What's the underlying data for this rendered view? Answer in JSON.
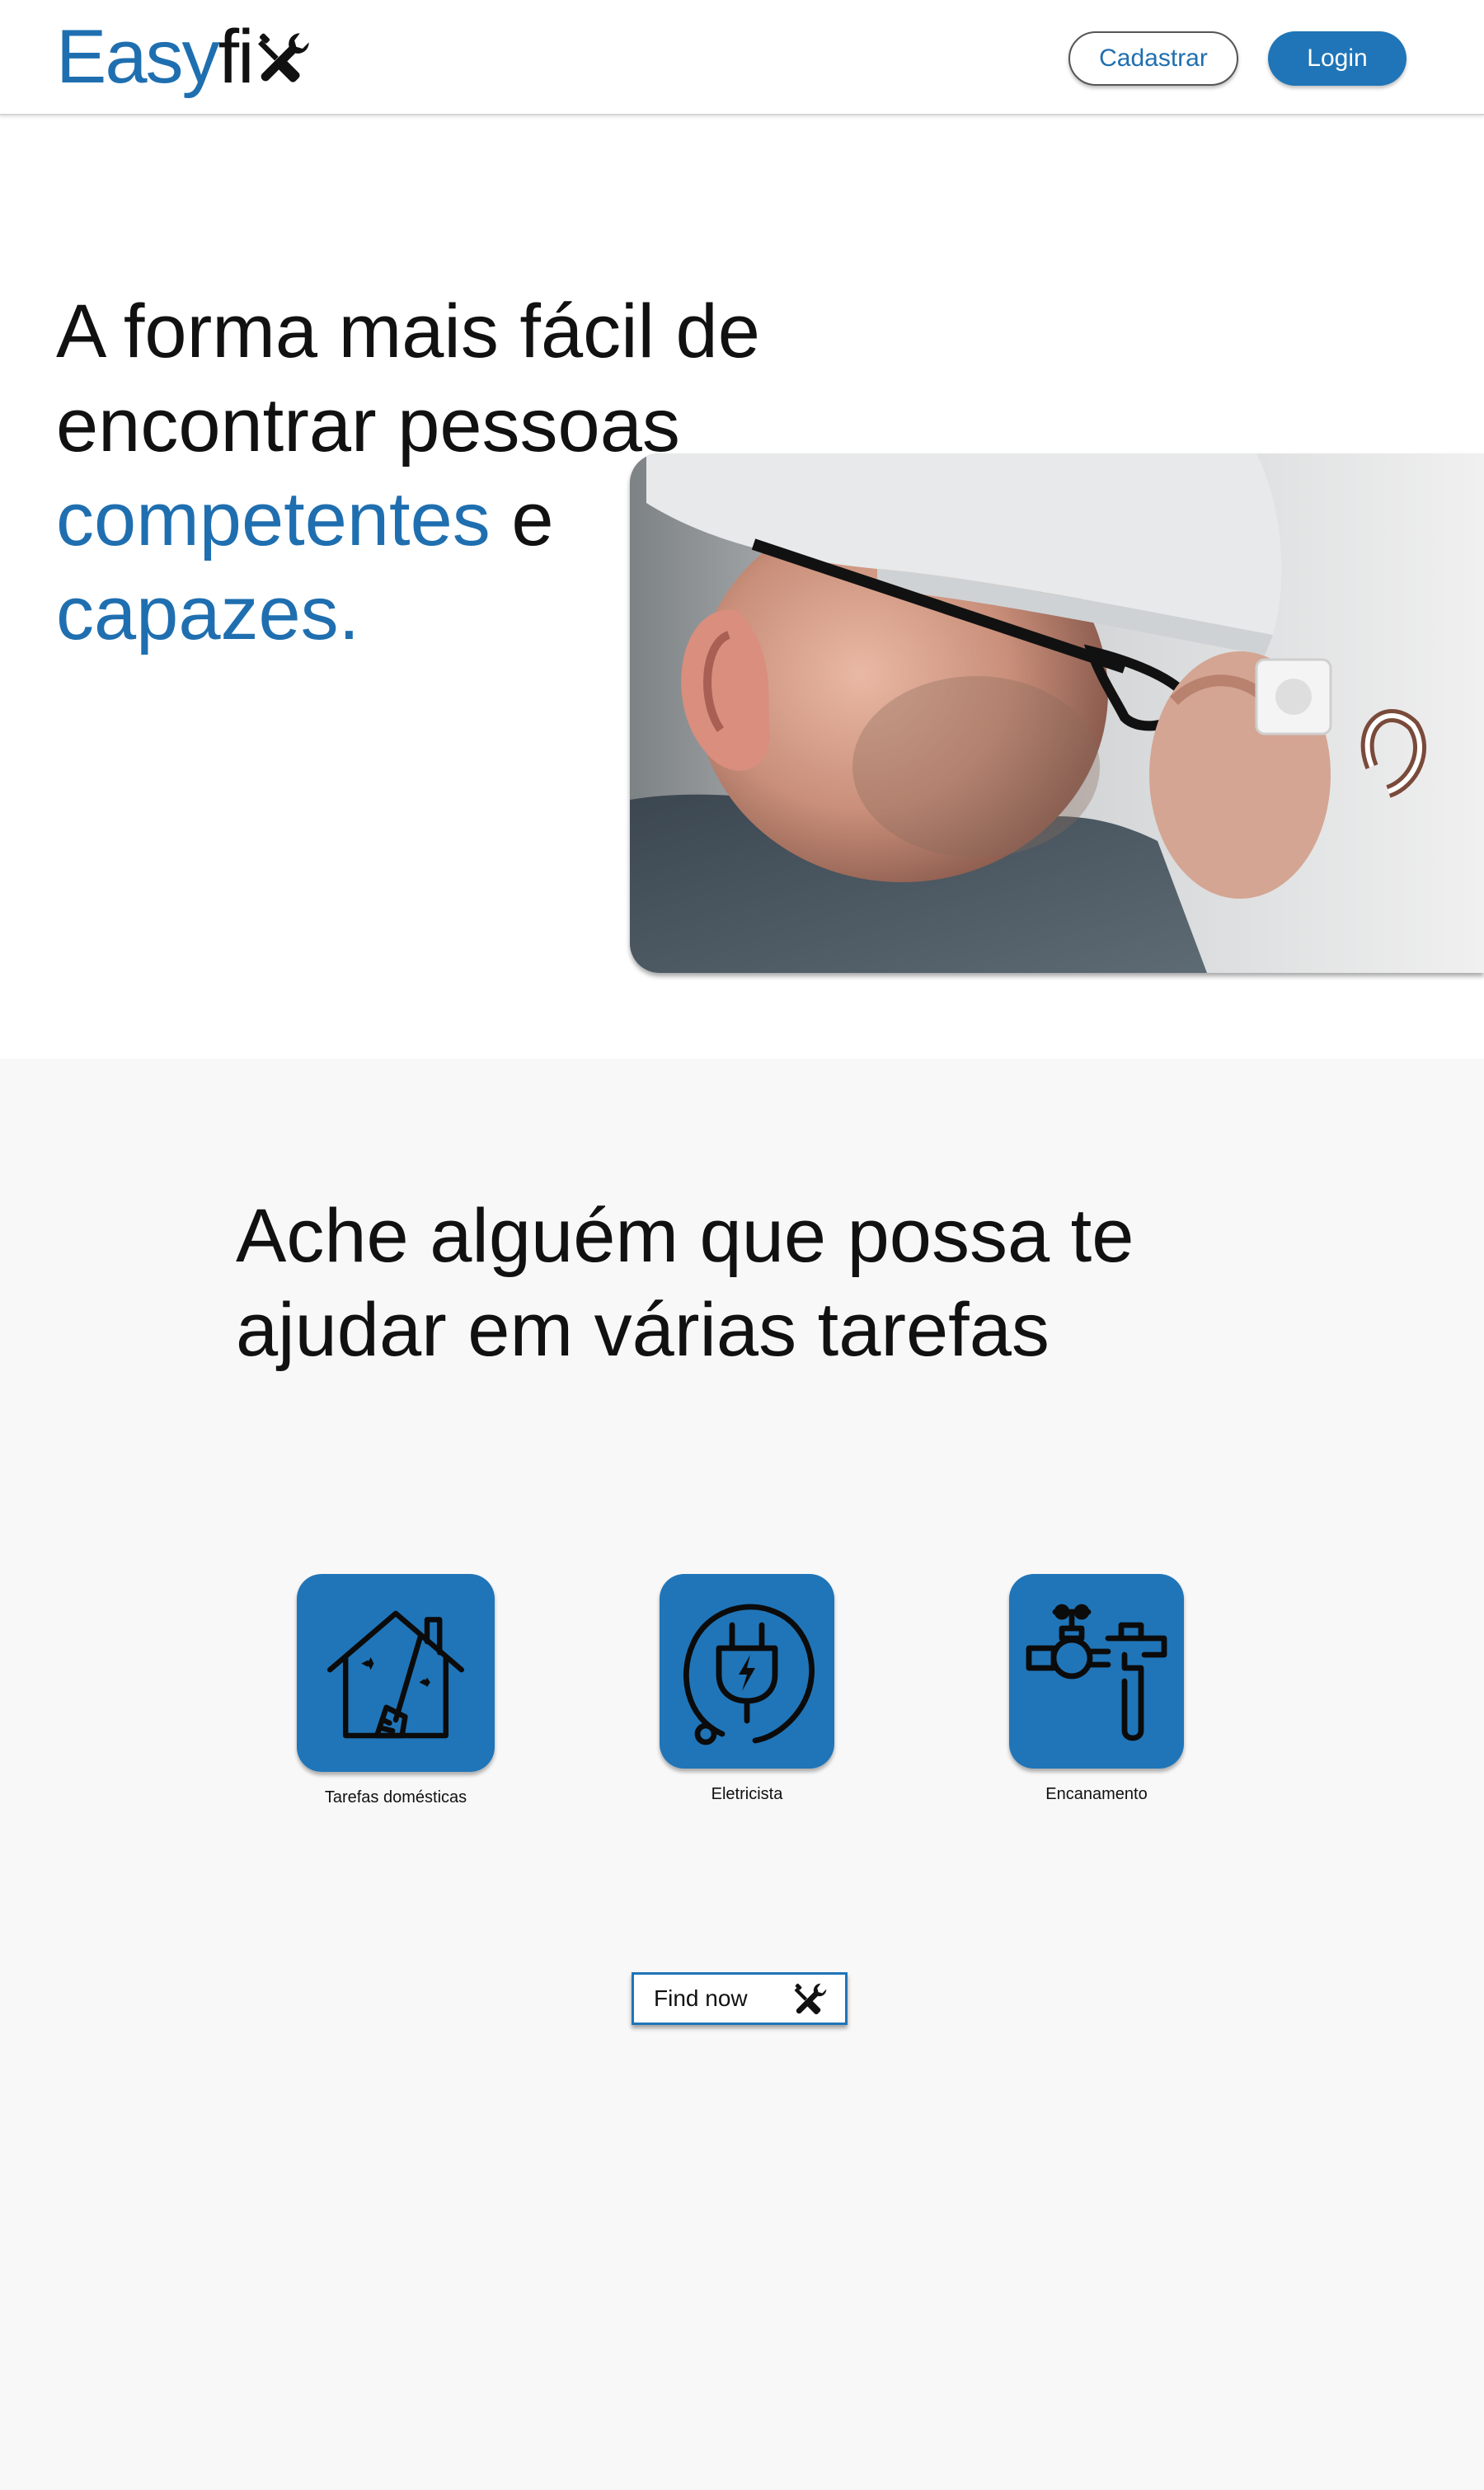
{
  "header": {
    "logo_easy": "Easy",
    "logo_fi": "fi",
    "logo_icon": "wrench-screwdriver-icon",
    "signup_label": "Cadastrar",
    "login_label": "Login"
  },
  "hero": {
    "line1": "A forma mais fácil de",
    "line2": "encontrar pessoas",
    "accent1": "competentes",
    "connector": " e",
    "accent2": "capazes.",
    "photo": "electrician-at-work-photo"
  },
  "services": {
    "title_line1": "Ache alguém que possa te",
    "title_line2": "ajudar em várias tarefas",
    "items": [
      {
        "label": "Tarefas domésticas",
        "icon": "house-broom-icon"
      },
      {
        "label": "Eletricista",
        "icon": "electric-plug-icon"
      },
      {
        "label": "Encanamento",
        "icon": "pipe-wrench-icon"
      }
    ],
    "cta_label": "Find now",
    "cta_icon": "wrench-screwdriver-icon"
  },
  "colors": {
    "brand_blue": "#1f6fb0",
    "tile_blue": "#2075b8",
    "section_bg": "#f8f8f8"
  }
}
